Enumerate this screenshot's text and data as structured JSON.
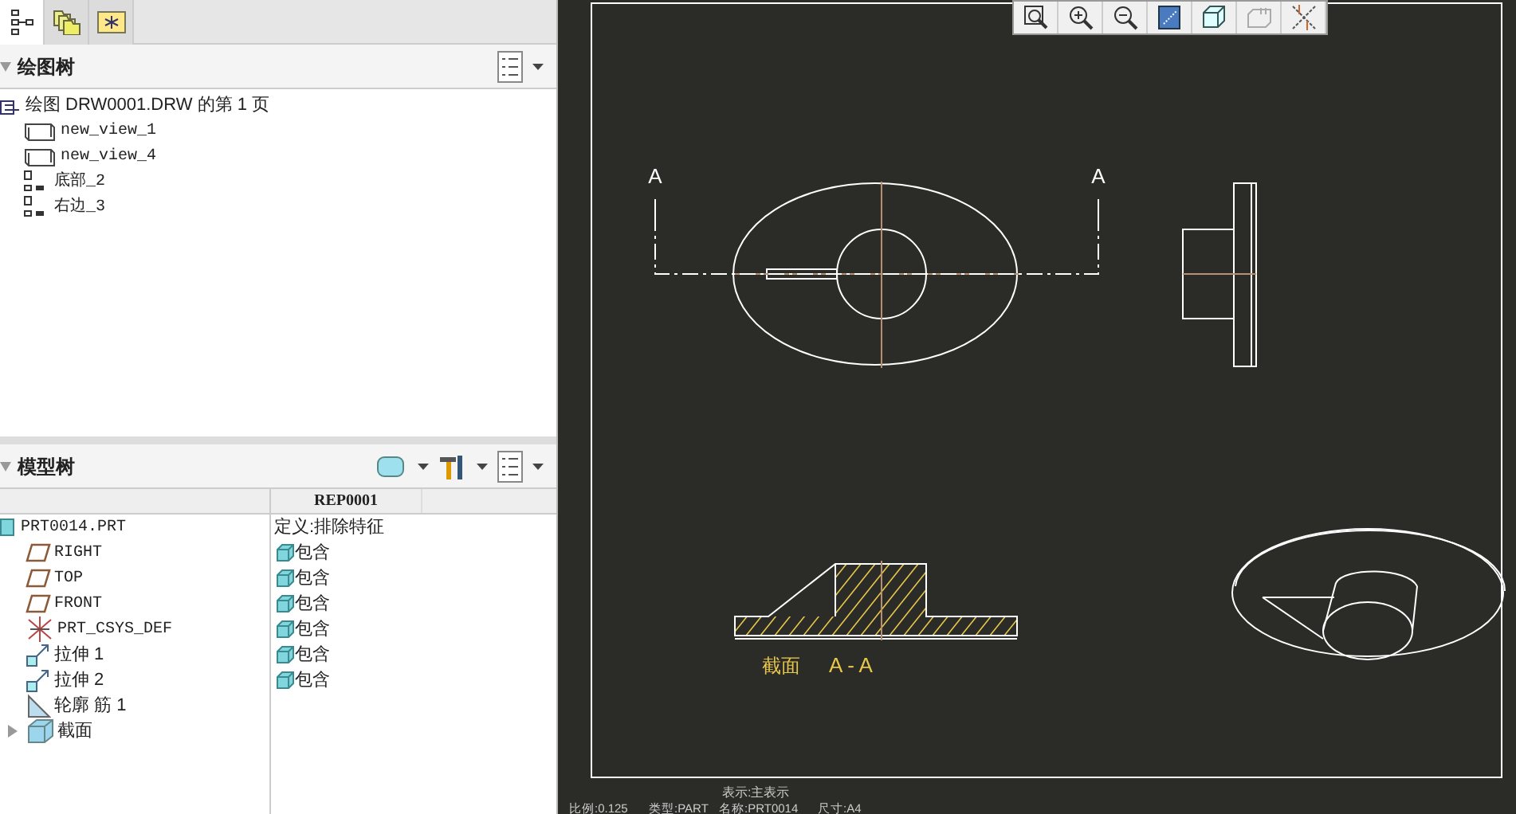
{
  "tabs": [
    {
      "kind": "tree",
      "selected": true
    },
    {
      "kind": "folders",
      "selected": false
    },
    {
      "kind": "favorites",
      "selected": false
    }
  ],
  "drawing_tree": {
    "title": "绘图树",
    "root": {
      "label": "绘图 DRW0001.DRW 的第 1 页",
      "kind": "sheet",
      "children": [
        {
          "label": "new_view_1",
          "kind": "view"
        },
        {
          "label": "new_view_4",
          "kind": "view"
        },
        {
          "label": "底部_2",
          "kind": "layer"
        },
        {
          "label": "右边_3",
          "kind": "layer"
        }
      ]
    }
  },
  "model_tree": {
    "title": "模型树",
    "column": "REP0001",
    "root": {
      "label": "PRT0014.PRT",
      "kind": "part",
      "value": "定义:排除特征",
      "children": [
        {
          "label": "RIGHT",
          "kind": "plane",
          "value": "包含"
        },
        {
          "label": "TOP",
          "kind": "plane",
          "value": "包含"
        },
        {
          "label": "FRONT",
          "kind": "plane",
          "value": "包含"
        },
        {
          "label": "PRT_CSYS_DEF",
          "kind": "csys",
          "value": "包含"
        },
        {
          "label": "拉伸 1",
          "kind": "extrude",
          "value": "包含"
        },
        {
          "label": "拉伸 2",
          "kind": "extrude",
          "value": "包含"
        },
        {
          "label": "轮廓 筋 1",
          "kind": "rib"
        },
        {
          "label": "截面",
          "kind": "section",
          "expanded": false
        }
      ]
    }
  },
  "toolbar": [
    {
      "kind": "zoom-window"
    },
    {
      "kind": "zoom-in"
    },
    {
      "kind": "zoom-out"
    },
    {
      "kind": "repaint"
    },
    {
      "kind": "shade"
    },
    {
      "kind": "annotation"
    },
    {
      "kind": "datum"
    }
  ],
  "canvas": {
    "section_marks": [
      "A",
      "A"
    ],
    "section_caption": {
      "name": "截面",
      "id": "A - A"
    },
    "status": {
      "display": "表示:主表示",
      "scale": "比例:0.125",
      "type": "类型:PART",
      "name": "名称:PRT0014",
      "size": "尺寸:A4"
    }
  }
}
